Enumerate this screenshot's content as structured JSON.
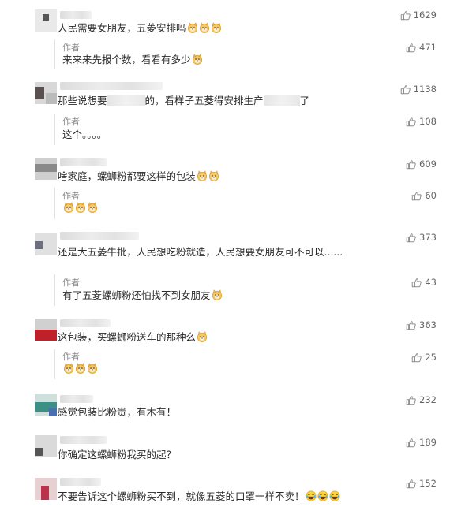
{
  "author_label": "作者",
  "comments": [
    {
      "text": "人民需要女朋友，五菱安排吗",
      "emojis": 3,
      "likes": "1629",
      "reply": {
        "text": "来来来先报个数，看看有多少",
        "emojis": 1,
        "likes": "471"
      }
    },
    {
      "text_pre": "那些说想要",
      "text_mid": "的，看样子五菱得安排生产",
      "text_post": "了",
      "likes": "1138",
      "reply": {
        "text": "这个。。。。",
        "emojis": 0,
        "likes": "108"
      }
    },
    {
      "text": "啥家庭，螺蛳粉都要这样的包装",
      "emojis": 2,
      "likes": "609",
      "reply": {
        "text": "",
        "emojis": 3,
        "likes": "60"
      }
    },
    {
      "text": "还是大五菱牛批，人民想吃粉就造，人民想要女朋友可不可以......",
      "emojis": 0,
      "likes": "373",
      "reply": {
        "text": "有了五菱螺蛳粉还怕找不到女朋友",
        "emojis": 1,
        "likes": "43"
      }
    },
    {
      "text": "这包装，买螺蛳粉送车的那种么",
      "emojis": 1,
      "likes": "363",
      "reply": {
        "text": "",
        "emojis": 3,
        "likes": "25"
      }
    },
    {
      "text": "感觉包装比粉贵，有木有！",
      "emojis": 0,
      "likes": "232"
    },
    {
      "text": "你确定这螺蛳粉我买的起？",
      "emojis": 0,
      "likes": "189"
    },
    {
      "text": "不要告诉这个螺蛳粉买不到，就像五菱的口罩一样不卖！",
      "laugh_emojis": 3,
      "likes": "152"
    }
  ],
  "icons": {
    "like": "thumbs-up-icon",
    "emoji": "doge-emoji-icon",
    "laugh": "laugh-cry-emoji-icon"
  },
  "colors": {
    "like_icon": "#8a8a8a",
    "text": "#2a2a2a",
    "author": "#8a8a8a"
  }
}
